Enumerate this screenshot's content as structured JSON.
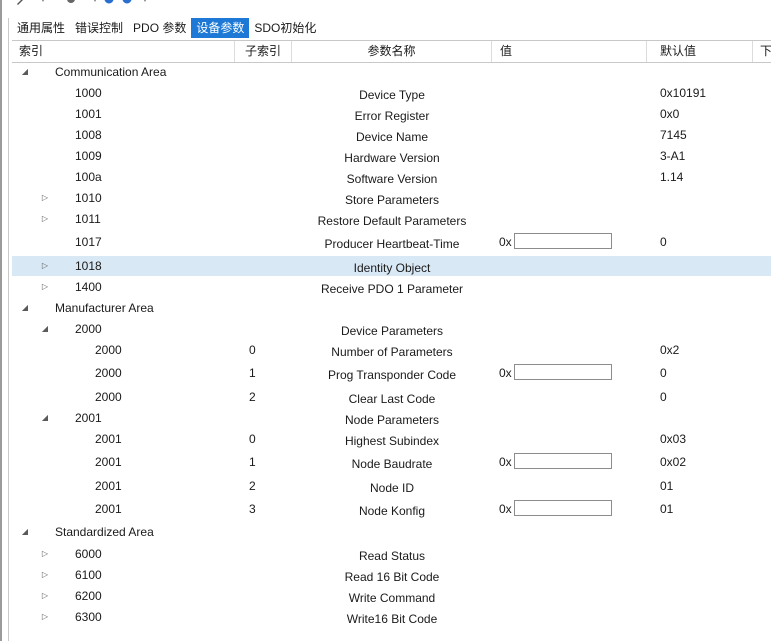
{
  "tabs": [
    "通用属性",
    "错误控制",
    "PDO 参数",
    "设备参数",
    "SDO初始化"
  ],
  "active_tab_index": 3,
  "columns": [
    "索引",
    "子索引",
    "参数名称",
    "值",
    "默认值",
    "下"
  ],
  "value_prefix": "0x",
  "rows": [
    {
      "level": 0,
      "expand": "expanded",
      "index": "Communication Area",
      "sub": "",
      "name": "",
      "value_field": false,
      "default": ""
    },
    {
      "level": 1,
      "expand": "",
      "index": "1000",
      "sub": "",
      "name": "Device Type",
      "value_field": false,
      "default": "0x10191"
    },
    {
      "level": 1,
      "expand": "",
      "index": "1001",
      "sub": "",
      "name": "Error Register",
      "value_field": false,
      "default": "0x0"
    },
    {
      "level": 1,
      "expand": "",
      "index": "1008",
      "sub": "",
      "name": "Device Name",
      "value_field": false,
      "default": "7145"
    },
    {
      "level": 1,
      "expand": "",
      "index": "1009",
      "sub": "",
      "name": "Hardware Version",
      "value_field": false,
      "default": "3-A1"
    },
    {
      "level": 1,
      "expand": "",
      "index": "100a",
      "sub": "",
      "name": "Software Version",
      "value_field": false,
      "default": "1.14"
    },
    {
      "level": 1,
      "expand": "collapsed",
      "index": "1010",
      "sub": "",
      "name": "Store Parameters",
      "value_field": false,
      "default": ""
    },
    {
      "level": 1,
      "expand": "collapsed",
      "index": "1011",
      "sub": "",
      "name": "Restore Default Parameters",
      "value_field": false,
      "default": ""
    },
    {
      "level": 1,
      "expand": "",
      "index": "1017",
      "sub": "",
      "name": "Producer Heartbeat-Time",
      "value_field": true,
      "default": "0"
    },
    {
      "level": 1,
      "expand": "collapsed",
      "index": "1018",
      "sub": "",
      "name": "Identity Object",
      "value_field": false,
      "default": "",
      "selected": true
    },
    {
      "level": 1,
      "expand": "collapsed",
      "index": "1400",
      "sub": "",
      "name": "Receive PDO 1 Parameter",
      "value_field": false,
      "default": ""
    },
    {
      "level": 0,
      "expand": "expanded",
      "index": "Manufacturer Area",
      "sub": "",
      "name": "",
      "value_field": false,
      "default": ""
    },
    {
      "level": 1,
      "expand": "expanded",
      "index": "2000",
      "sub": "",
      "name": "Device Parameters",
      "value_field": false,
      "default": ""
    },
    {
      "level": 2,
      "expand": "",
      "index": "2000",
      "sub": "0",
      "name": "Number of Parameters",
      "value_field": false,
      "default": "0x2"
    },
    {
      "level": 2,
      "expand": "",
      "index": "2000",
      "sub": "1",
      "name": "Prog Transponder Code",
      "value_field": true,
      "default": "0"
    },
    {
      "level": 2,
      "expand": "",
      "index": "2000",
      "sub": "2",
      "name": "Clear Last Code",
      "value_field": false,
      "default": "0"
    },
    {
      "level": 1,
      "expand": "expanded",
      "index": "2001",
      "sub": "",
      "name": "Node Parameters",
      "value_field": false,
      "default": ""
    },
    {
      "level": 2,
      "expand": "",
      "index": "2001",
      "sub": "0",
      "name": "Highest Subindex",
      "value_field": false,
      "default": "0x03"
    },
    {
      "level": 2,
      "expand": "",
      "index": "2001",
      "sub": "1",
      "name": "Node Baudrate",
      "value_field": true,
      "default": "0x02"
    },
    {
      "level": 2,
      "expand": "",
      "index": "2001",
      "sub": "2",
      "name": "Node ID",
      "value_field": false,
      "default": "01"
    },
    {
      "level": 2,
      "expand": "",
      "index": "2001",
      "sub": "3",
      "name": "Node Konfig",
      "value_field": true,
      "default": "01"
    },
    {
      "level": 0,
      "expand": "expanded",
      "index": "Standardized Area",
      "sub": "",
      "name": "",
      "value_field": false,
      "default": ""
    },
    {
      "level": 1,
      "expand": "collapsed",
      "index": "6000",
      "sub": "",
      "name": "Read Status",
      "value_field": false,
      "default": ""
    },
    {
      "level": 1,
      "expand": "collapsed",
      "index": "6100",
      "sub": "",
      "name": "Read 16 Bit Code",
      "value_field": false,
      "default": ""
    },
    {
      "level": 1,
      "expand": "collapsed",
      "index": "6200",
      "sub": "",
      "name": "Write Command",
      "value_field": false,
      "default": ""
    },
    {
      "level": 1,
      "expand": "collapsed",
      "index": "6300",
      "sub": "",
      "name": "Write16 Bit Code",
      "value_field": false,
      "default": ""
    }
  ],
  "colors": {
    "accent": "#1e79d6",
    "selected_row": "#d9e8f5"
  }
}
